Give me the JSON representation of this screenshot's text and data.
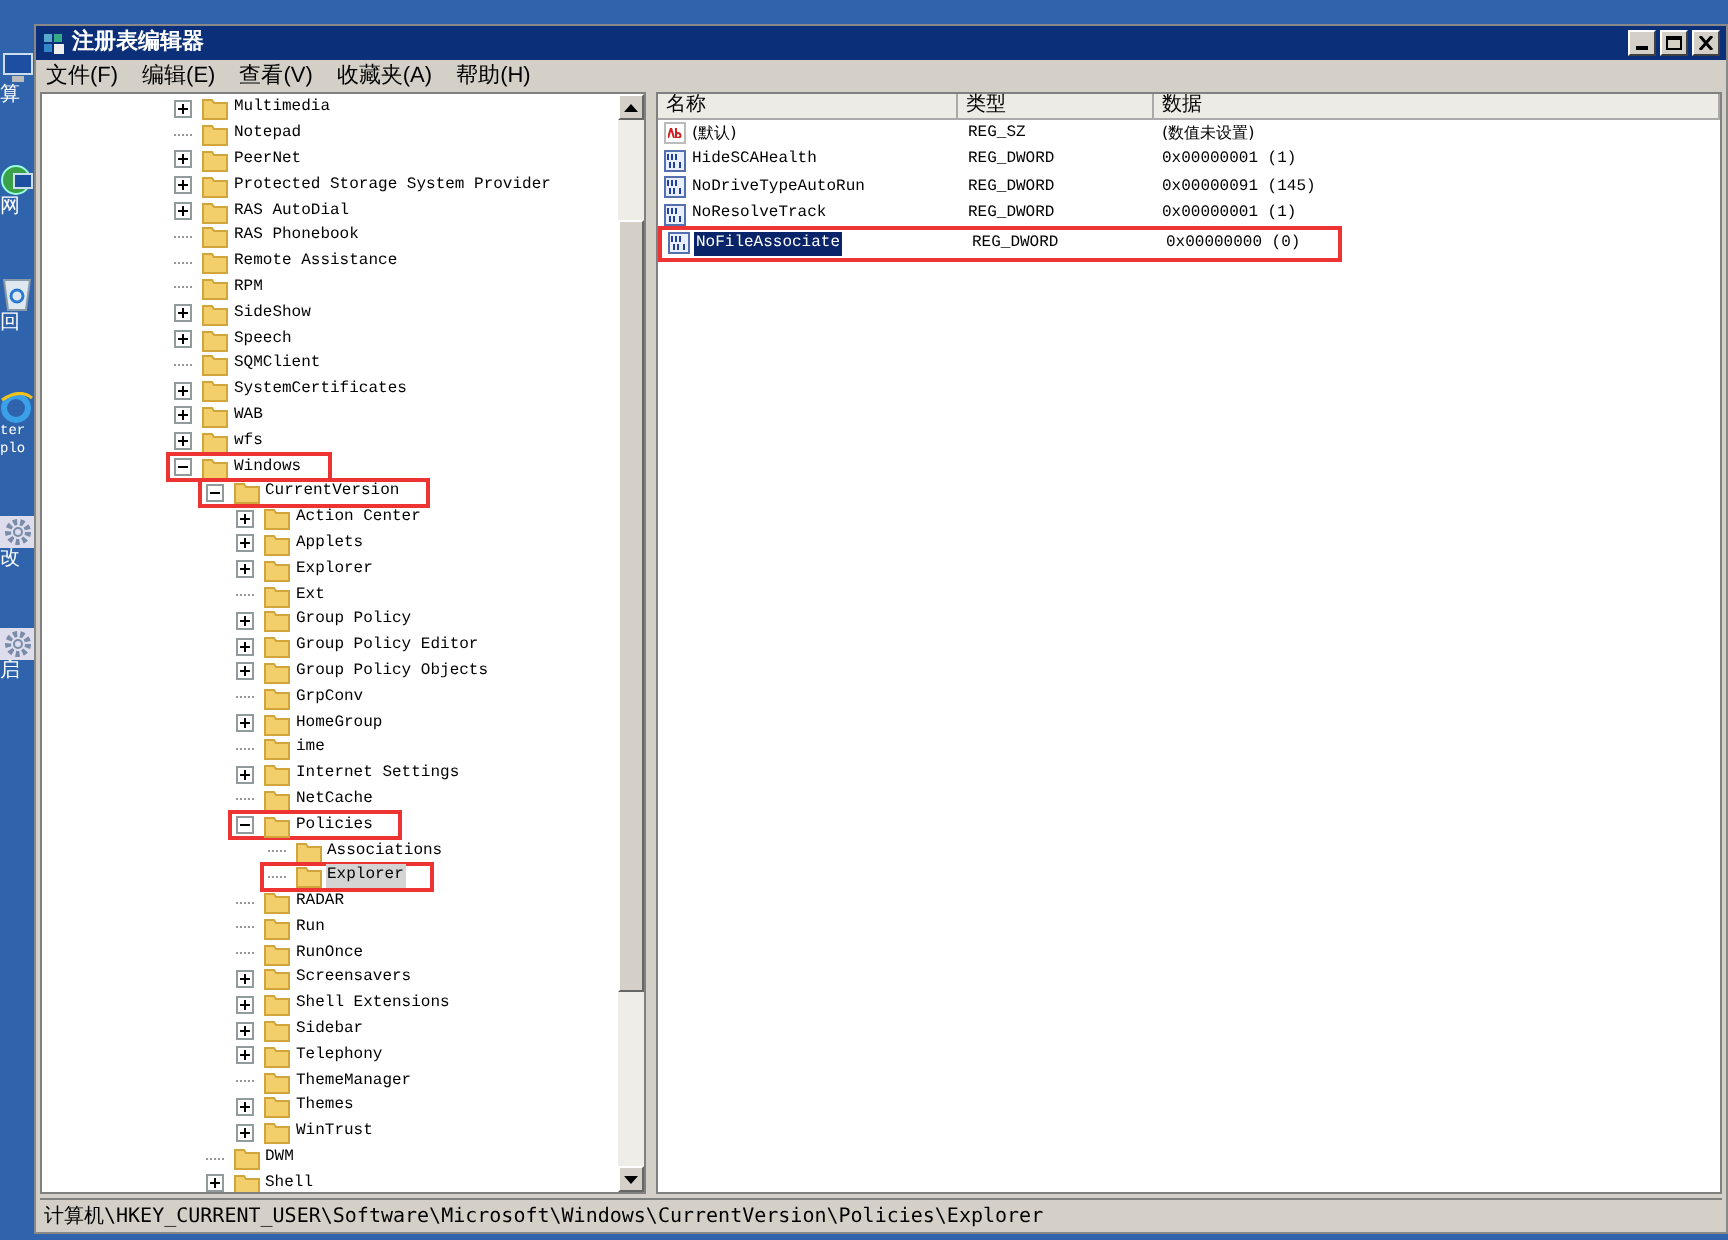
{
  "desktop_icons": [
    {
      "kind": "computer",
      "label": [
        "算"
      ]
    },
    {
      "kind": "network",
      "label": [
        "网"
      ]
    },
    {
      "kind": "recycle",
      "label": [
        "回"
      ]
    },
    {
      "kind": "browser",
      "label": [
        "ter",
        "plo"
      ]
    },
    {
      "kind": "gear",
      "label": [
        "改"
      ]
    },
    {
      "kind": "gear",
      "label": [
        "启"
      ]
    }
  ],
  "window": {
    "title": "注册表编辑器"
  },
  "menu": [
    "文件(F)",
    "编辑(E)",
    "查看(V)",
    "收藏夹(A)",
    "帮助(H)"
  ],
  "tree": [
    {
      "label": "Multimedia",
      "kind": "branch",
      "expanded": false,
      "selected": false,
      "highlighted": false
    },
    {
      "label": "Notepad",
      "kind": "leaf",
      "selected": false,
      "highlighted": false
    },
    {
      "label": "PeerNet",
      "kind": "branch",
      "expanded": false,
      "selected": false,
      "highlighted": false
    },
    {
      "label": "Protected Storage System Provider",
      "kind": "branch",
      "expanded": false,
      "selected": false,
      "highlighted": false
    },
    {
      "label": "RAS AutoDial",
      "kind": "branch",
      "expanded": false,
      "selected": false,
      "highlighted": false
    },
    {
      "label": "RAS Phonebook",
      "kind": "leaf",
      "selected": false,
      "highlighted": false
    },
    {
      "label": "Remote Assistance",
      "kind": "leaf",
      "selected": false,
      "highlighted": false
    },
    {
      "label": "RPM",
      "kind": "leaf",
      "selected": false,
      "highlighted": false
    },
    {
      "label": "SideShow",
      "kind": "branch",
      "expanded": false,
      "selected": false,
      "highlighted": false
    },
    {
      "label": "Speech",
      "kind": "branch",
      "expanded": false,
      "selected": false,
      "highlighted": false
    },
    {
      "label": "SQMClient",
      "kind": "leaf",
      "selected": false,
      "highlighted": false
    },
    {
      "label": "SystemCertificates",
      "kind": "branch",
      "expanded": false,
      "selected": false,
      "highlighted": false
    },
    {
      "label": "WAB",
      "kind": "branch",
      "expanded": false,
      "selected": false,
      "highlighted": false
    },
    {
      "label": "wfs",
      "kind": "branch",
      "expanded": false,
      "selected": false,
      "highlighted": false
    },
    {
      "label": "Windows",
      "kind": "branch",
      "expanded": true,
      "selected": false,
      "highlighted": true,
      "children": [
        {
          "label": "CurrentVersion",
          "kind": "branch",
          "expanded": true,
          "selected": false,
          "highlighted": true,
          "children": [
            {
              "label": "Action Center",
              "kind": "branch",
              "expanded": false,
              "selected": false,
              "highlighted": false
            },
            {
              "label": "Applets",
              "kind": "branch",
              "expanded": false,
              "selected": false,
              "highlighted": false
            },
            {
              "label": "Explorer",
              "kind": "branch",
              "expanded": false,
              "selected": false,
              "highlighted": false
            },
            {
              "label": "Ext",
              "kind": "leaf",
              "selected": false,
              "highlighted": false
            },
            {
              "label": "Group Policy",
              "kind": "branch",
              "expanded": false,
              "selected": false,
              "highlighted": false
            },
            {
              "label": "Group Policy Editor",
              "kind": "branch",
              "expanded": false,
              "selected": false,
              "highlighted": false
            },
            {
              "label": "Group Policy Objects",
              "kind": "branch",
              "expanded": false,
              "selected": false,
              "highlighted": false
            },
            {
              "label": "GrpConv",
              "kind": "leaf",
              "selected": false,
              "highlighted": false
            },
            {
              "label": "HomeGroup",
              "kind": "branch",
              "expanded": false,
              "selected": false,
              "highlighted": false
            },
            {
              "label": "ime",
              "kind": "leaf",
              "selected": false,
              "highlighted": false
            },
            {
              "label": "Internet Settings",
              "kind": "branch",
              "expanded": false,
              "selected": false,
              "highlighted": false
            },
            {
              "label": "NetCache",
              "kind": "leaf",
              "selected": false,
              "highlighted": false
            },
            {
              "label": "Policies",
              "kind": "branch",
              "expanded": true,
              "selected": false,
              "highlighted": true,
              "children": [
                {
                  "label": "Associations",
                  "kind": "leaf",
                  "selected": false,
                  "highlighted": false
                },
                {
                  "label": "Explorer",
                  "kind": "leaf",
                  "selected": true,
                  "highlighted": true
                }
              ]
            },
            {
              "label": "RADAR",
              "kind": "leaf",
              "selected": false,
              "highlighted": false
            },
            {
              "label": "Run",
              "kind": "leaf",
              "selected": false,
              "highlighted": false
            },
            {
              "label": "RunOnce",
              "kind": "leaf",
              "selected": false,
              "highlighted": false
            },
            {
              "label": "Screensavers",
              "kind": "branch",
              "expanded": false,
              "selected": false,
              "highlighted": false
            },
            {
              "label": "Shell Extensions",
              "kind": "branch",
              "expanded": false,
              "selected": false,
              "highlighted": false
            },
            {
              "label": "Sidebar",
              "kind": "branch",
              "expanded": false,
              "selected": false,
              "highlighted": false
            },
            {
              "label": "Telephony",
              "kind": "branch",
              "expanded": false,
              "selected": false,
              "highlighted": false
            },
            {
              "label": "ThemeManager",
              "kind": "leaf",
              "selected": false,
              "highlighted": false
            },
            {
              "label": "Themes",
              "kind": "branch",
              "expanded": false,
              "selected": false,
              "highlighted": false
            },
            {
              "label": "WinTrust",
              "kind": "branch",
              "expanded": false,
              "selected": false,
              "highlighted": false
            }
          ]
        },
        {
          "label": "DWM",
          "kind": "leaf",
          "selected": false,
          "highlighted": false
        },
        {
          "label": "Shell",
          "kind": "branch",
          "expanded": false,
          "selected": false,
          "highlighted": false
        }
      ]
    }
  ],
  "values": {
    "columns": [
      "名称",
      "类型",
      "数据"
    ],
    "rows": [
      {
        "kind": "string",
        "name": "(默认)",
        "type": "REG_SZ",
        "data": "(数值未设置)",
        "selected": false,
        "highlighted": false
      },
      {
        "kind": "dword",
        "name": "HideSCAHealth",
        "type": "REG_DWORD",
        "data": "0x00000001 (1)",
        "selected": false,
        "highlighted": false
      },
      {
        "kind": "dword",
        "name": "NoDriveTypeAutoRun",
        "type": "REG_DWORD",
        "data": "0x00000091 (145)",
        "selected": false,
        "highlighted": false
      },
      {
        "kind": "dword",
        "name": "NoResolveTrack",
        "type": "REG_DWORD",
        "data": "0x00000001 (1)",
        "selected": false,
        "highlighted": false
      },
      {
        "kind": "dword",
        "name": "NoFileAssociate",
        "type": "REG_DWORD",
        "data": "0x00000000 (0)",
        "selected": true,
        "highlighted": true
      }
    ]
  },
  "status_bar": "计算机\\HKEY_CURRENT_USER\\Software\\Microsoft\\Windows\\CurrentVersion\\Policies\\Explorer"
}
